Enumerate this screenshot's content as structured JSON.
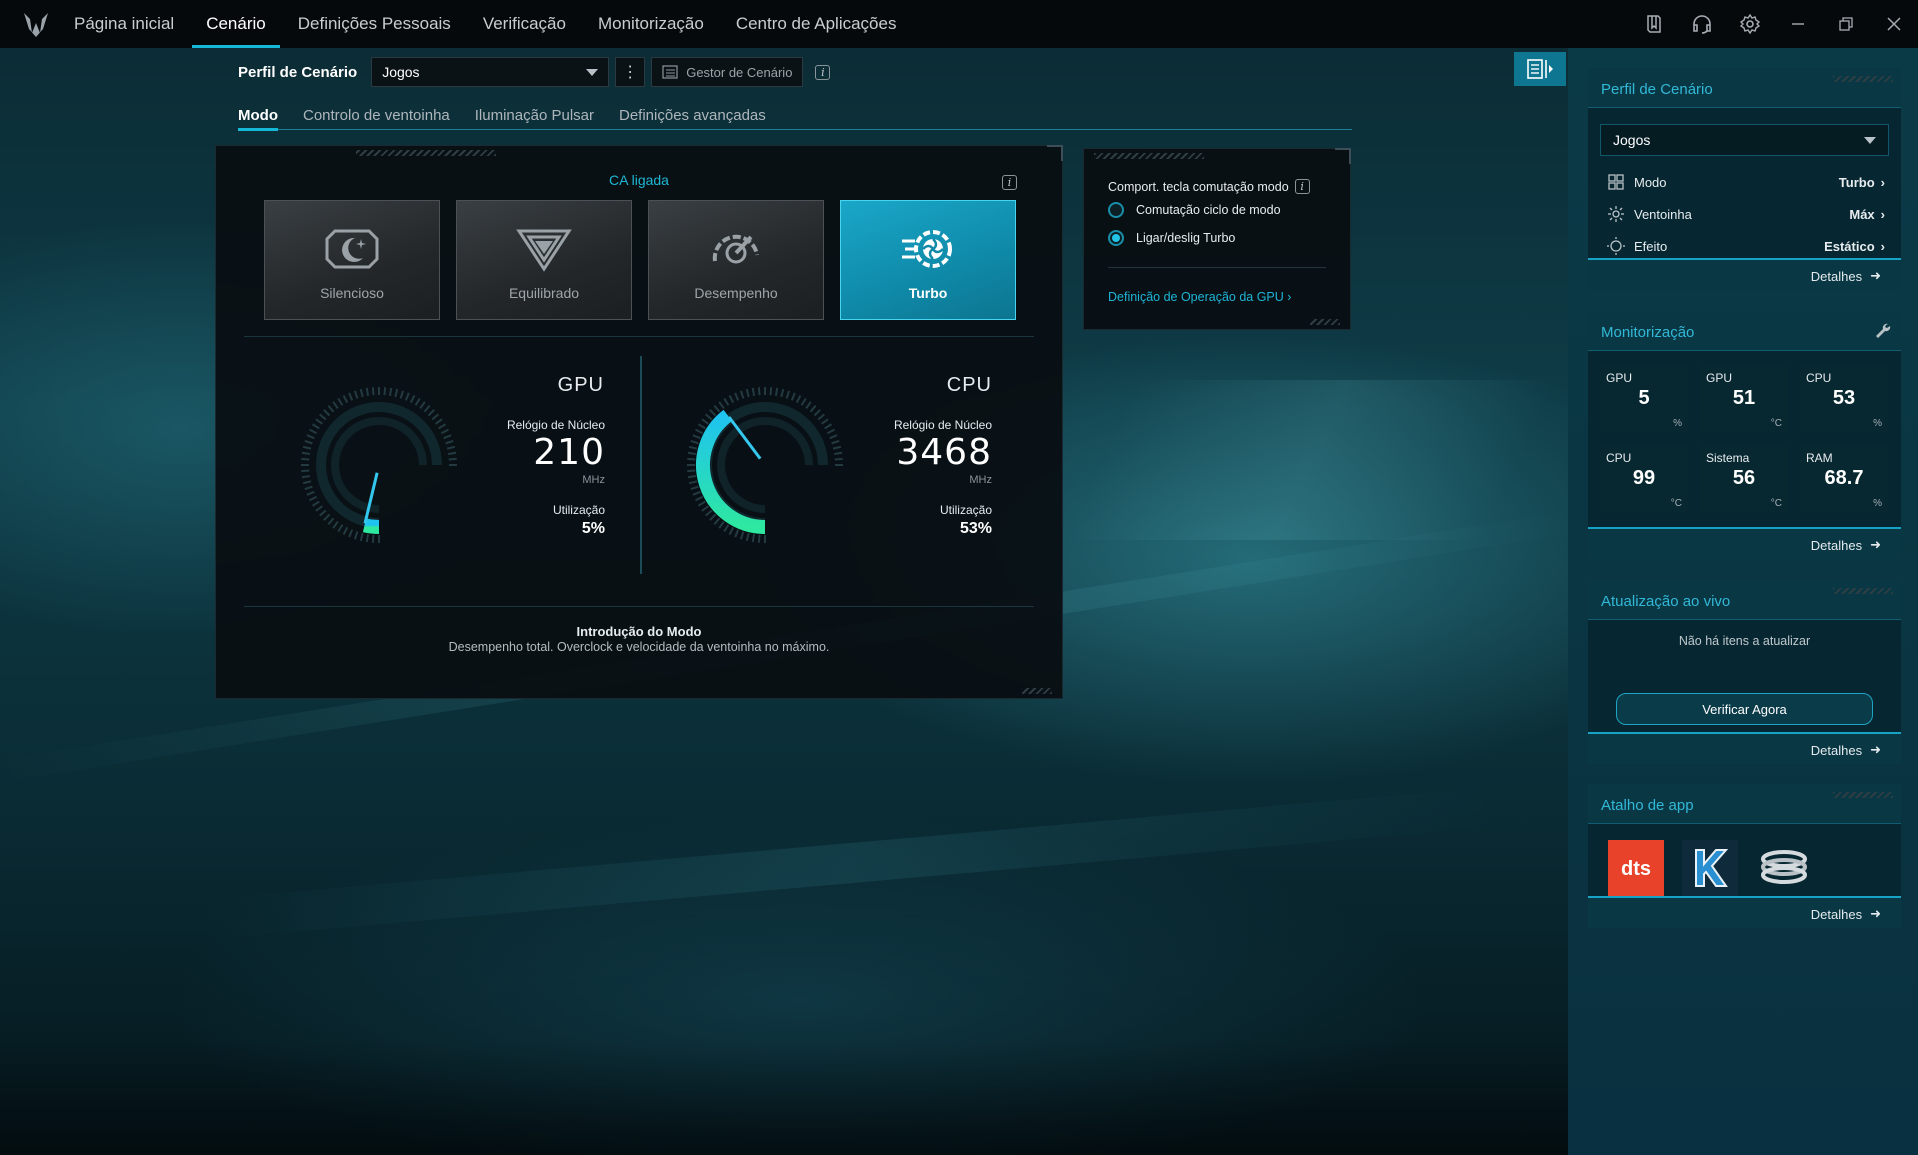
{
  "topbar": {
    "nav": [
      "Página inicial",
      "Cenário",
      "Definições Pessoais",
      "Verificação",
      "Monitorização",
      "Centro de Aplicações"
    ],
    "active_index": 1
  },
  "profile": {
    "label": "Perfil de Cenário",
    "selected": "Jogos",
    "manager": "Gestor de Cenário"
  },
  "subtabs": [
    "Modo",
    "Controlo de ventoinha",
    "Iluminação Pulsar",
    "Definições avançadas"
  ],
  "mode": {
    "power_status": "CA ligada",
    "tiles": [
      "Silencioso",
      "Equilibrado",
      "Desempenho",
      "Turbo"
    ],
    "active_tile": "Turbo",
    "gpu": {
      "title": "GPU",
      "clock_label": "Relógio de Núcleo",
      "clock_value": "210",
      "clock_unit": "MHz",
      "util_label": "Utilização",
      "util_value": "5%",
      "util_fraction": 0.05
    },
    "cpu": {
      "title": "CPU",
      "clock_label": "Relógio de Núcleo",
      "clock_value": "3468",
      "clock_unit": "MHz",
      "util_label": "Utilização",
      "util_value": "53%",
      "util_fraction": 0.53
    },
    "intro_title": "Introdução do Modo",
    "intro_desc": "Desempenho total. Overclock e velocidade da ventoinha no máximo."
  },
  "comport": {
    "title": "Comport. tecla comutação modo",
    "options": [
      "Comutação ciclo de modo",
      "Ligar/deslig Turbo"
    ],
    "selected_index": 1,
    "gpu_link": "Definição de Operação da GPU"
  },
  "sidebar": {
    "profile_card": {
      "title": "Perfil de Cenário",
      "selected": "Jogos",
      "rows": [
        {
          "label": "Modo",
          "value": "Turbo",
          "icon": "grid-icon"
        },
        {
          "label": "Ventoinha",
          "value": "Máx",
          "icon": "fan-icon"
        },
        {
          "label": "Efeito",
          "value": "Estático",
          "icon": "light-icon"
        }
      ],
      "details": "Detalhes"
    },
    "monitor_card": {
      "title": "Monitorização",
      "cells": [
        {
          "label": "GPU",
          "value": "5",
          "unit": "%"
        },
        {
          "label": "GPU",
          "value": "51",
          "unit": "°C"
        },
        {
          "label": "CPU",
          "value": "53",
          "unit": "%"
        },
        {
          "label": "CPU",
          "value": "99",
          "unit": "°C"
        },
        {
          "label": "Sistema",
          "value": "56",
          "unit": "°C"
        },
        {
          "label": "RAM",
          "value": "68.7",
          "unit": "%"
        }
      ],
      "details": "Detalhes"
    },
    "update_card": {
      "title": "Atualização ao vivo",
      "message": "Não há itens a atualizar",
      "button": "Verificar Agora",
      "details": "Detalhes"
    },
    "apps_card": {
      "title": "Atalho de app",
      "apps": [
        {
          "name": "dts",
          "color": "#e8432a"
        },
        {
          "name": "K",
          "color": "#1e4a6e"
        },
        {
          "name": "coil",
          "color": "#c8ced2"
        }
      ],
      "details": "Detalhes"
    }
  },
  "colors": {
    "accent": "#16b8d8",
    "turbo_tile": "#1aa7c9",
    "gauge_cyan": "#1fc3f0",
    "gauge_green": "#2ee8a0"
  }
}
